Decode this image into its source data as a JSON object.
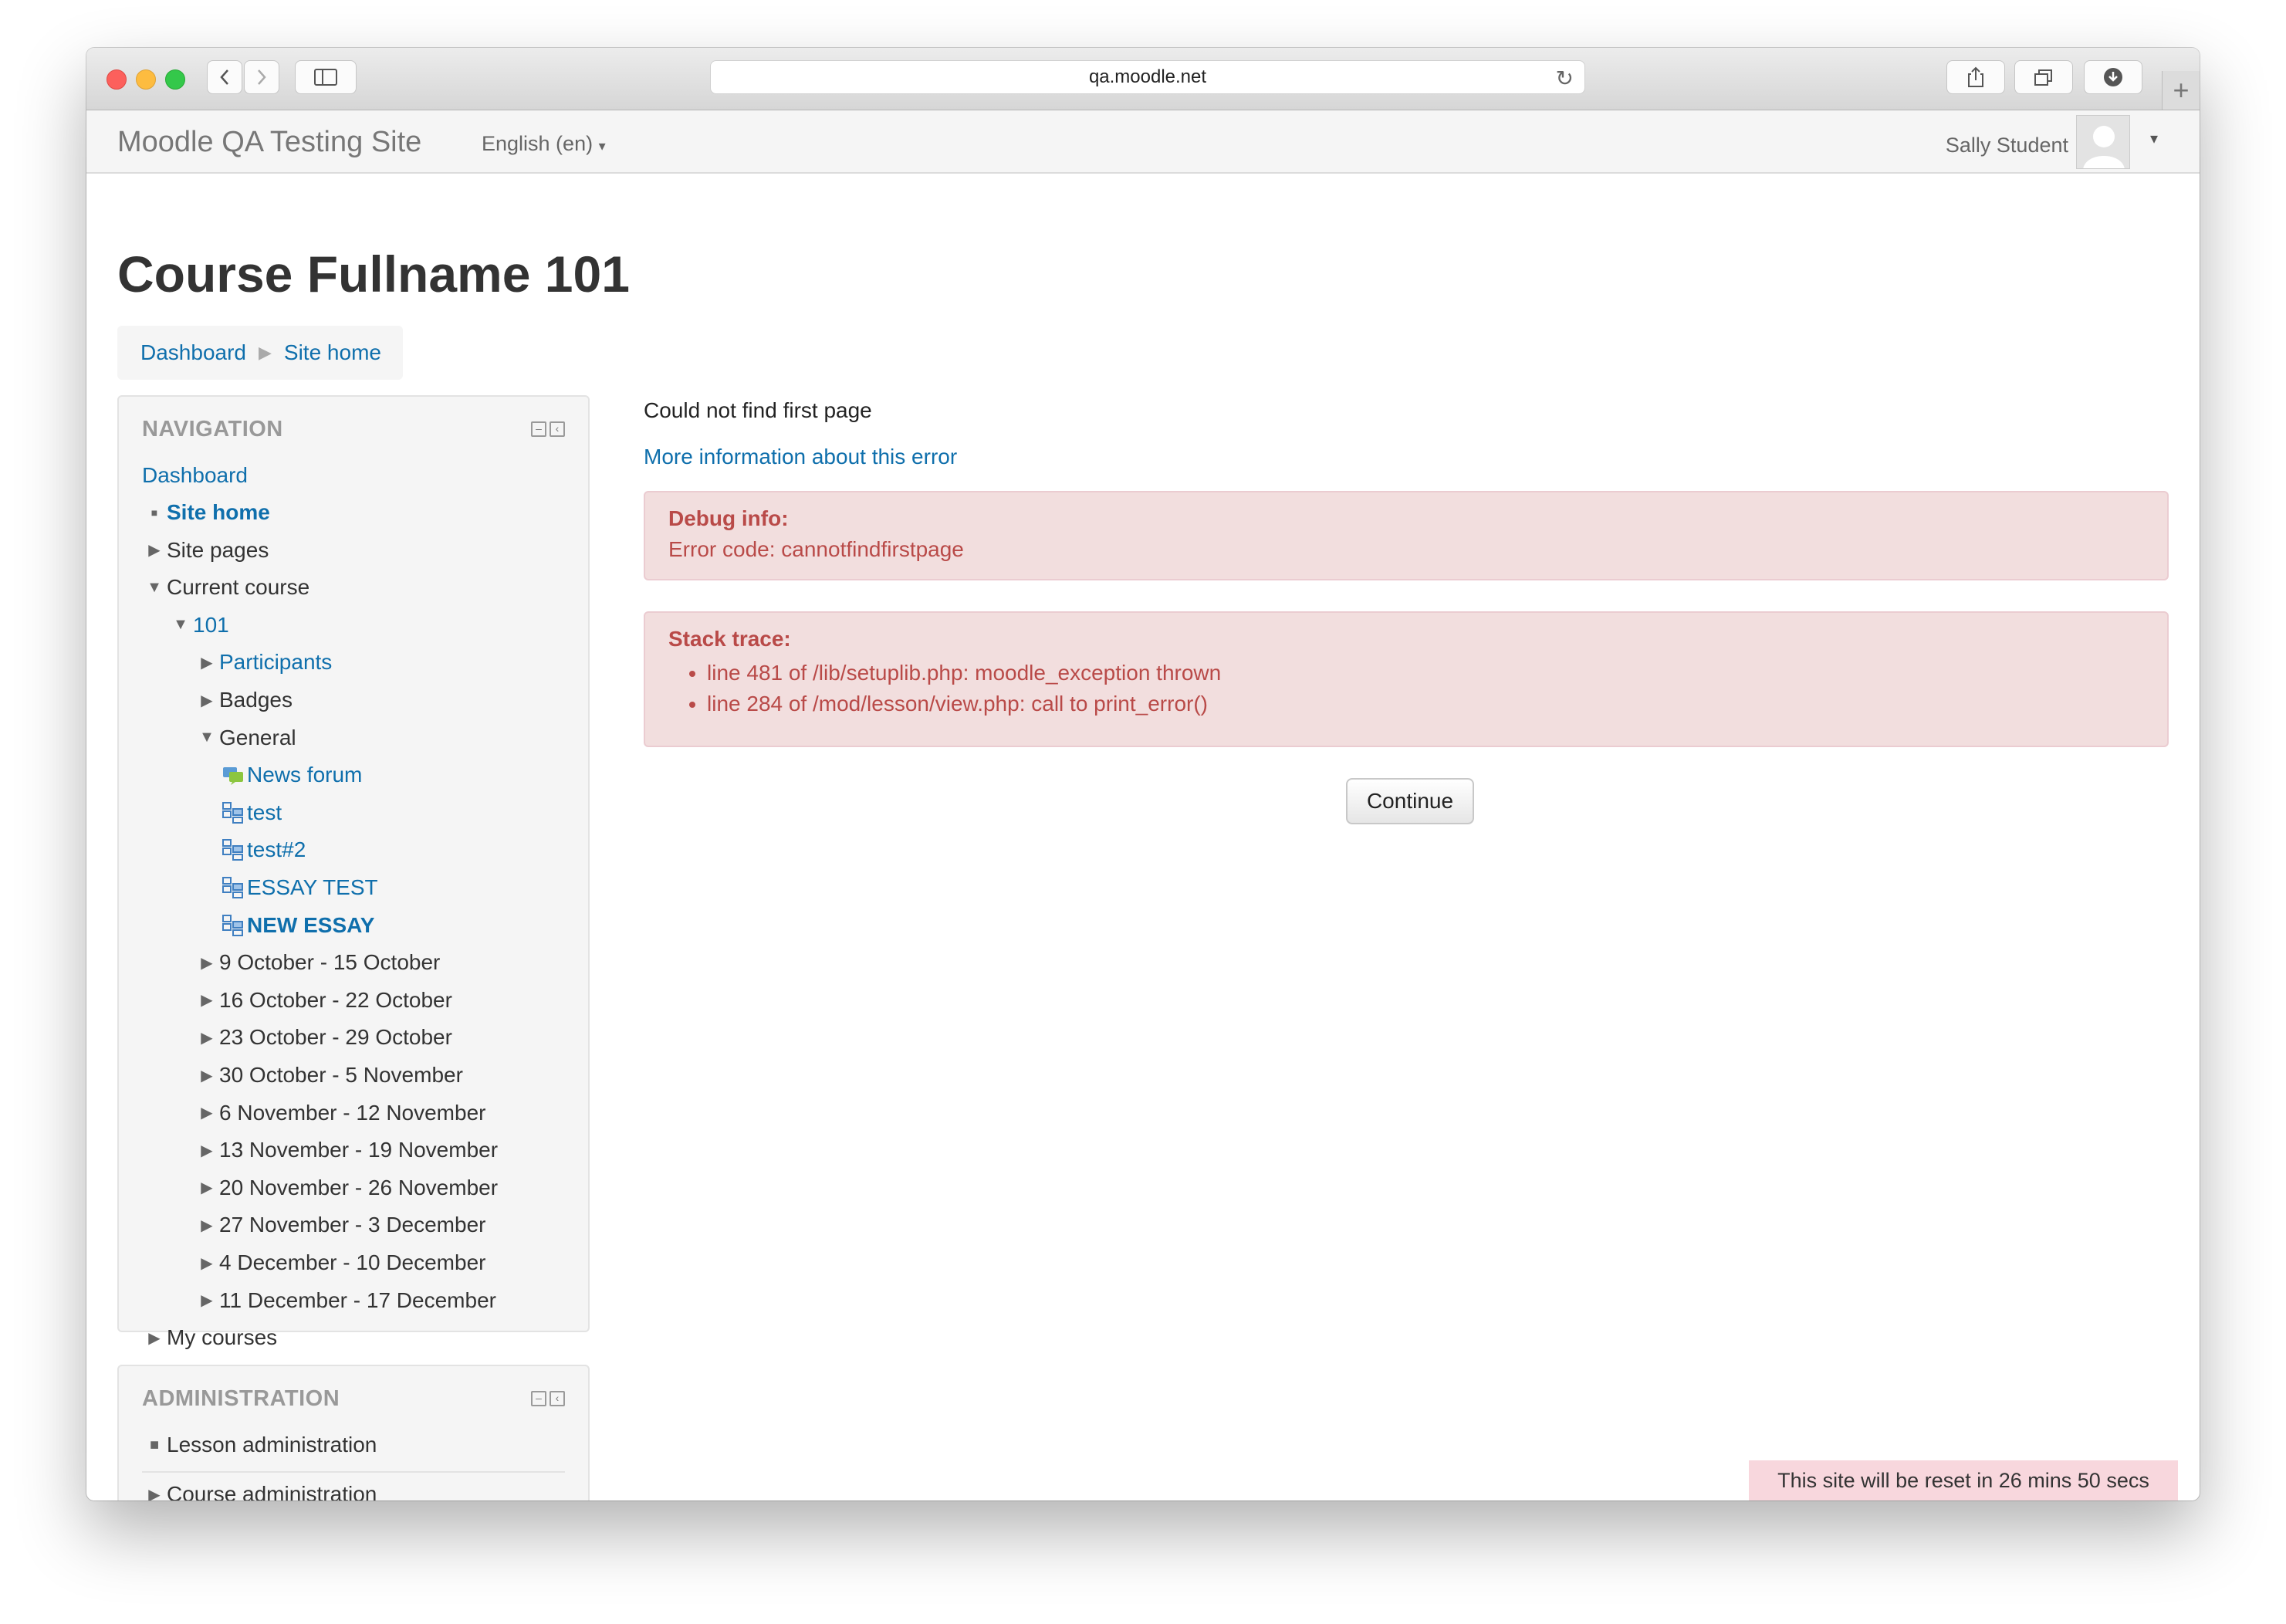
{
  "browser": {
    "url": "qa.moodle.net"
  },
  "navbar": {
    "brand": "Moodle QA Testing Site",
    "language": "English (en)",
    "user": "Sally Student"
  },
  "page": {
    "title": "Course Fullname 101",
    "breadcrumb": [
      "Dashboard",
      "Site home"
    ]
  },
  "navigation": {
    "heading": "NAVIGATION",
    "dashboard": "Dashboard",
    "items": [
      {
        "label": "Site home",
        "link": true,
        "bold": true,
        "marker": "bullet"
      },
      {
        "label": "Site pages",
        "link": false,
        "marker": "collapsed"
      },
      {
        "label": "Current course",
        "link": false,
        "marker": "expanded"
      },
      {
        "label": "101",
        "link": true,
        "marker": "expanded"
      },
      {
        "label": "Participants",
        "link": true,
        "marker": "collapsed"
      },
      {
        "label": "Badges",
        "link": false,
        "marker": "collapsed"
      },
      {
        "label": "General",
        "link": false,
        "marker": "expanded"
      },
      {
        "label": "News forum",
        "link": true,
        "marker": "forum-icon"
      },
      {
        "label": "test",
        "link": true,
        "marker": "lesson-icon"
      },
      {
        "label": "test#2",
        "link": true,
        "marker": "lesson-icon"
      },
      {
        "label": "ESSAY TEST",
        "link": true,
        "marker": "lesson-icon"
      },
      {
        "label": "NEW ESSAY",
        "link": true,
        "bold": true,
        "marker": "lesson-icon"
      },
      {
        "label": "9 October - 15 October",
        "link": false,
        "marker": "collapsed"
      },
      {
        "label": "16 October - 22 October",
        "link": false,
        "marker": "collapsed"
      },
      {
        "label": "23 October - 29 October",
        "link": false,
        "marker": "collapsed"
      },
      {
        "label": "30 October - 5 November",
        "link": false,
        "marker": "collapsed"
      },
      {
        "label": "6 November - 12 November",
        "link": false,
        "marker": "collapsed"
      },
      {
        "label": "13 November - 19 November",
        "link": false,
        "marker": "collapsed"
      },
      {
        "label": "20 November - 26 November",
        "link": false,
        "marker": "collapsed"
      },
      {
        "label": "27 November - 3 December",
        "link": false,
        "marker": "collapsed"
      },
      {
        "label": "4 December - 10 December",
        "link": false,
        "marker": "collapsed"
      },
      {
        "label": "11 December - 17 December",
        "link": false,
        "marker": "collapsed"
      },
      {
        "label": "My courses",
        "link": false,
        "marker": "collapsed"
      }
    ]
  },
  "administration": {
    "heading": "ADMINISTRATION",
    "items": [
      {
        "label": "Lesson administration",
        "marker": "bullet"
      },
      {
        "label": "Course administration",
        "marker": "collapsed"
      }
    ]
  },
  "main": {
    "message": "Could not find first page",
    "more_info": "More information about this error",
    "debug_heading": "Debug info:",
    "debug_text": "Error code: cannotfindfirstpage",
    "stack_heading": "Stack trace:",
    "stack": [
      "line 481 of /lib/setuplib.php: moodle_exception thrown",
      "line 284 of /mod/lesson/view.php: call to print_error()"
    ],
    "continue_label": "Continue"
  },
  "footer": {
    "reset_notice": "This site will be reset in 26 mins 50 secs"
  }
}
